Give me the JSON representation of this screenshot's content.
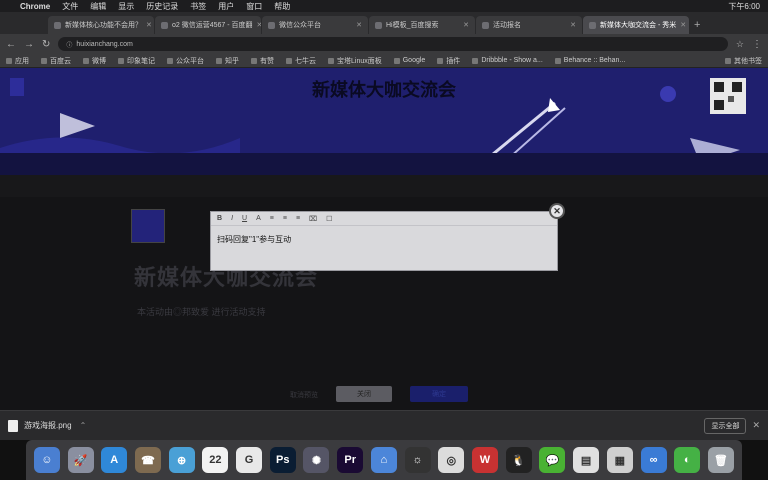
{
  "menubar": {
    "apple": "",
    "app": "Chrome",
    "items": [
      "文件",
      "编辑",
      "显示",
      "历史记录",
      "书签",
      "用户",
      "窗口",
      "帮助"
    ],
    "clock": "下午6:00"
  },
  "tabs": [
    {
      "label": "新媒体核心功能不会用？"
    },
    {
      "label": "o2 微信运营4567 - 百度翻"
    },
    {
      "label": "微信公众平台"
    },
    {
      "label": "Hi模板_百度搜索"
    },
    {
      "label": "活动报名"
    },
    {
      "label": "新媒体大咖交流会 - 秀米",
      "active": true
    }
  ],
  "address": {
    "url": "huixianchang.com"
  },
  "bookmarks": [
    "应用",
    "百度云",
    "微博",
    "印象笔记",
    "公众平台",
    "知乎",
    "有赞",
    "七牛云",
    "宝塔Linux面板",
    "Google",
    "插件",
    "Dribbble - Show a...",
    "Behance :: Behan..."
  ],
  "bookmarks_other": "其他书签",
  "banner": {
    "title": "新媒体大咖交流会"
  },
  "page": {
    "event_title": "新媒体大咖交流会",
    "event_desc": "本活动由◎邦致爱 进行活动支持"
  },
  "footer_buttons": {
    "cancel": "取消预览",
    "close": "关闭",
    "confirm": "确定"
  },
  "popup": {
    "toolbar": [
      "B",
      "I",
      "U",
      "A",
      "≡",
      "≡",
      "≡",
      "⌧",
      "☐"
    ],
    "body": "扫码回复\"1\"参与互动",
    "close_glyph": "✕"
  },
  "downloads": {
    "file": "游戏海报.png",
    "show_all": "显示全部",
    "close": "✕"
  },
  "dock": [
    {
      "name": "finder",
      "color": "#4a7fd1",
      "glyph": "☺"
    },
    {
      "name": "launchpad",
      "color": "#8a8fa0",
      "glyph": "🚀"
    },
    {
      "name": "app-store",
      "color": "#2f88d8",
      "glyph": "A"
    },
    {
      "name": "contacts",
      "color": "#7e6a50",
      "glyph": "☎"
    },
    {
      "name": "safari",
      "color": "#4aa0d6",
      "glyph": "⊕"
    },
    {
      "name": "calendar",
      "color": "#f2f2f2",
      "glyph": "22"
    },
    {
      "name": "notes-g",
      "color": "#e8e8e8",
      "glyph": "G"
    },
    {
      "name": "photoshop",
      "color": "#0a1d33",
      "glyph": "Ps"
    },
    {
      "name": "compass",
      "color": "#556",
      "glyph": "✺"
    },
    {
      "name": "premiere",
      "color": "#1a0a33",
      "glyph": "Pr"
    },
    {
      "name": "keynote",
      "color": "#4c86d9",
      "glyph": "⌂"
    },
    {
      "name": "app-dark",
      "color": "#333",
      "glyph": "☼"
    },
    {
      "name": "chrome",
      "color": "#dcdcdc",
      "glyph": "◎"
    },
    {
      "name": "wps",
      "color": "#c83232",
      "glyph": "W"
    },
    {
      "name": "qq",
      "color": "#222",
      "glyph": "🐧"
    },
    {
      "name": "wechat",
      "color": "#49b233",
      "glyph": "💬"
    },
    {
      "name": "file",
      "color": "#e0e0e0",
      "glyph": "▤"
    },
    {
      "name": "preview",
      "color": "#cfcfcf",
      "glyph": "▦"
    },
    {
      "name": "baidu-pan",
      "color": "#3a7bd5",
      "glyph": "∞"
    },
    {
      "name": "wechat-dev",
      "color": "#45b145",
      "glyph": "◐"
    },
    {
      "name": "trash",
      "color": "#9aa0a6",
      "glyph": "🗑"
    }
  ]
}
